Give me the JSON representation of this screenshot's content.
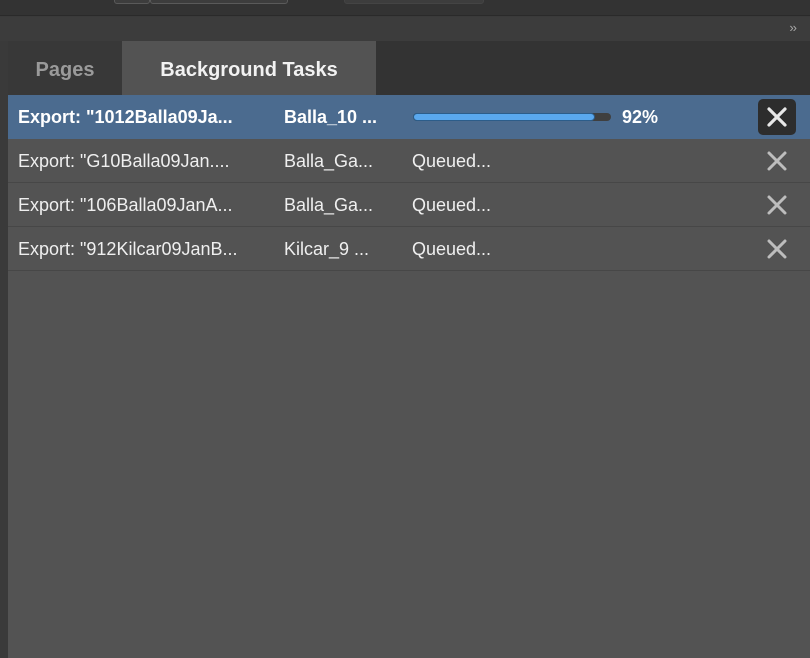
{
  "panel": {
    "collapse_label": "››",
    "tabs": [
      {
        "label": "Pages",
        "active": false
      },
      {
        "label": "Background Tasks",
        "active": true
      }
    ]
  },
  "tasks": [
    {
      "name": "Export: \"1012Balla09Ja...",
      "file": "Balla_10 ...",
      "status": "",
      "progress": 92,
      "progress_label": "92%",
      "selected": true
    },
    {
      "name": "Export: \"G10Balla09Jan....",
      "file": "Balla_Ga...",
      "status": "Queued...",
      "selected": false
    },
    {
      "name": "Export: \"106Balla09JanA...",
      "file": "Balla_Ga...",
      "status": "Queued...",
      "selected": false
    },
    {
      "name": "Export: \"912Kilcar09JanB...",
      "file": "Kilcar_9 ...",
      "status": "Queued...",
      "selected": false
    }
  ],
  "icons": {
    "cancel": "close-icon",
    "collapse": "double-chevron-right-icon"
  },
  "colors": {
    "selected_row": "#4b6b8f",
    "progress_fill": "#5aa8ee",
    "panel_bg": "#535353"
  }
}
